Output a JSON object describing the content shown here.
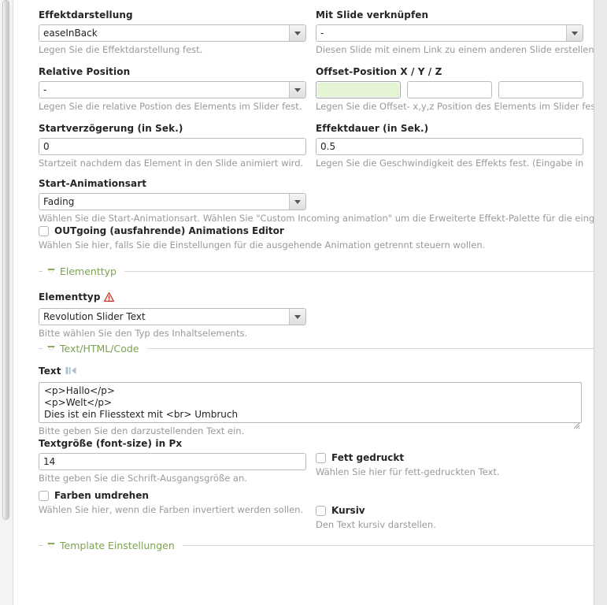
{
  "colors": {
    "legend_green": "#7ba352",
    "focus_green_bg": "#e6f4d6",
    "hint_gray": "#999999",
    "label_dark": "#252525",
    "panel_bg": "#ffffff",
    "page_bg": "#e9e9e9"
  },
  "fields": {
    "effect_style": {
      "label": "Effektdarstellung",
      "value": "easeInBack",
      "hint": "Legen Sie die Effektdarstellung fest.",
      "control": "select"
    },
    "link_slide": {
      "label": "Mit Slide verknüpfen",
      "value": "-",
      "hint": "Diesen Slide mit einem Link zu einem anderen Slide erstellen.",
      "control": "select"
    },
    "relative_position": {
      "label": "Relative Position",
      "value": "-",
      "hint": "Legen Sie die relative Postion des Elements im Slider fest.",
      "control": "select"
    },
    "offset_position": {
      "label": "Offset-Position X / Y / Z",
      "hint": "Legen Sie die Offset- x,y,z Position des Elements im Slider fest.",
      "x": "",
      "y": "",
      "z": "",
      "focused": "x"
    },
    "start_delay": {
      "label": "Startverzögerung (in Sek.)",
      "value": "0",
      "hint": "Startzeit nachdem das Element in den Slide animiert wird.",
      "control": "text"
    },
    "effect_duration": {
      "label": "Effektdauer (in Sek.)",
      "value": "0.5",
      "hint": "Legen Sie die Geschwindigkeit des Effekts fest. (Eingabe in",
      "control": "text"
    },
    "start_animation": {
      "label": "Start-Animationsart",
      "value": "Fading",
      "hint": "Wählen Sie die Start-Animationsart. Wählen Sie \"Custom Incoming animation\" um die Erweiterte Effekt-Palette für die eingehenden",
      "control": "select"
    },
    "outgoing_editor": {
      "label": "OUTgoing (ausfahrende) Animations Editor",
      "hint": "Wählen Sie hier, falls Sie die Einstellungen für die ausgehende Animation getrennt steuern wollen.",
      "checked": false
    },
    "element_type": {
      "label": "Elementtyp",
      "value": "Revolution Slider Text",
      "hint": "Bitte wählen Sie den Typ des Inhaltselements.",
      "warning_icon": "warning-triangle-icon",
      "control": "select"
    },
    "text_content": {
      "label": "Text",
      "icon": "add-media-icon",
      "value": "<p>Hallo</p>\n<p>Welt</p>\nDies ist ein Fliesstext mit <br> Umbruch",
      "hint": "Bitte geben Sie den darzustellenden Text ein."
    },
    "font_size": {
      "label": "Textgröße (font-size) in Px",
      "value": "14",
      "hint": "Bitte geben Sie die Schrift-Ausgangsgröße an.",
      "control": "text"
    },
    "bold": {
      "label": "Fett gedruckt",
      "hint": "Wählen Sie hier für fett-gedruckten Text.",
      "checked": false
    },
    "invert_colors": {
      "label": "Farben umdrehen",
      "hint": "Wählen Sie hier, wenn die Farben invertiert werden sollen.",
      "checked": false
    },
    "italic": {
      "label": "Kursiv",
      "hint": "Den Text kursiv darstellen.",
      "checked": false
    }
  },
  "sections": [
    {
      "key": "elementtyp",
      "label": "Elementtyp"
    },
    {
      "key": "text_html_code",
      "label": "Text/HTML/Code"
    },
    {
      "key": "template_settings",
      "label": "Template Einstellungen"
    }
  ]
}
